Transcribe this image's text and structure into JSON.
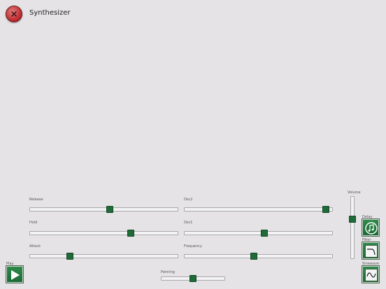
{
  "header": {
    "title": "Synthesizer",
    "close_icon": "close-icon"
  },
  "sliders": [
    {
      "id": "release",
      "label": "Release",
      "value": 0.54
    },
    {
      "id": "osc2",
      "label": "Osc2",
      "value": 0.98
    },
    {
      "id": "hold",
      "label": "Hold",
      "value": 0.69
    },
    {
      "id": "osc1",
      "label": "Osc1",
      "value": 0.54
    },
    {
      "id": "attack",
      "label": "Attack",
      "value": 0.26
    },
    {
      "id": "frequency",
      "label": "Frequency",
      "value": 0.47
    },
    {
      "id": "panning",
      "label": "Panning",
      "value": 0.5
    }
  ],
  "volume": {
    "label": "Volume",
    "value": 0.65
  },
  "buttons": {
    "play": {
      "label": "Play",
      "icon": "play-icon"
    },
    "delay": {
      "label": "Delay",
      "icon": "music-note-icon"
    },
    "filter": {
      "label": "Filter",
      "icon": "filter-curve-icon"
    },
    "waveform": {
      "label": "Sinewave",
      "icon": "sine-wave-icon"
    }
  },
  "colors": {
    "accent": "#1f6b38",
    "close": "#b8262a",
    "background": "#e5e3e6"
  }
}
